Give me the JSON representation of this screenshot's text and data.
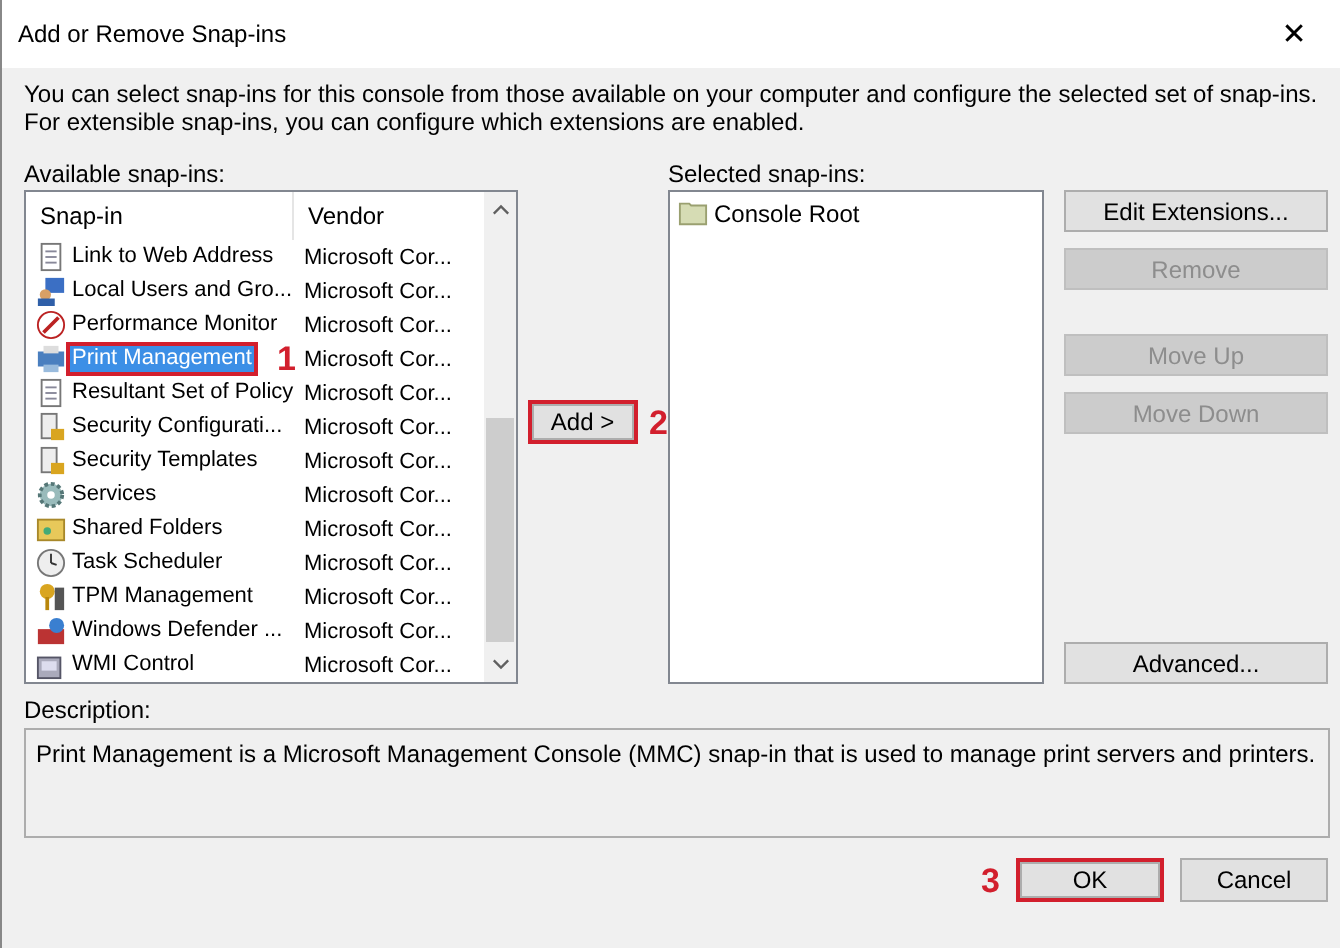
{
  "window": {
    "title": "Add or Remove Snap-ins",
    "close": "✕"
  },
  "intro": "You can select snap-ins for this console from those available on your computer and configure the selected set of snap-ins. For extensible snap-ins, you can configure which extensions are enabled.",
  "available": {
    "label": "Available snap-ins:",
    "columns": [
      "Snap-in",
      "Vendor"
    ],
    "rows": [
      {
        "name": "Link to Web Address",
        "vendor": "Microsoft Cor...",
        "selected": false,
        "marked": false
      },
      {
        "name": "Local Users and Gro...",
        "vendor": "Microsoft Cor...",
        "selected": false,
        "marked": false
      },
      {
        "name": "Performance Monitor",
        "vendor": "Microsoft Cor...",
        "selected": false,
        "marked": false
      },
      {
        "name": "Print Management",
        "vendor": "Microsoft Cor...",
        "selected": true,
        "marked": true,
        "callout": "1"
      },
      {
        "name": "Resultant Set of Policy",
        "vendor": "Microsoft Cor...",
        "selected": false,
        "marked": false
      },
      {
        "name": "Security Configurati...",
        "vendor": "Microsoft Cor...",
        "selected": false,
        "marked": false
      },
      {
        "name": "Security Templates",
        "vendor": "Microsoft Cor...",
        "selected": false,
        "marked": false
      },
      {
        "name": "Services",
        "vendor": "Microsoft Cor...",
        "selected": false,
        "marked": false
      },
      {
        "name": "Shared Folders",
        "vendor": "Microsoft Cor...",
        "selected": false,
        "marked": false
      },
      {
        "name": "Task Scheduler",
        "vendor": "Microsoft Cor...",
        "selected": false,
        "marked": false
      },
      {
        "name": "TPM Management",
        "vendor": "Microsoft Cor...",
        "selected": false,
        "marked": false
      },
      {
        "name": "Windows Defender ...",
        "vendor": "Microsoft Cor...",
        "selected": false,
        "marked": false
      },
      {
        "name": "WMI Control",
        "vendor": "Microsoft Cor...",
        "selected": false,
        "marked": false
      }
    ]
  },
  "add_button": {
    "label": "Add >",
    "marked": true,
    "callout": "2"
  },
  "selected": {
    "label": "Selected snap-ins:",
    "items": [
      {
        "name": "Console Root"
      }
    ]
  },
  "side_buttons": [
    {
      "label": "Edit Extensions...",
      "disabled": false
    },
    {
      "label": "Remove",
      "disabled": true
    },
    {
      "label": "Move Up",
      "disabled": true
    },
    {
      "label": "Move Down",
      "disabled": true
    },
    {
      "label": "Advanced...",
      "disabled": false
    }
  ],
  "description": {
    "label": "Description:",
    "text": "Print Management is a Microsoft Management Console (MMC) snap-in that is used to manage print servers and printers."
  },
  "footer_buttons": [
    {
      "label": "OK",
      "marked": true,
      "callout": "3"
    },
    {
      "label": "Cancel",
      "marked": false
    }
  ]
}
